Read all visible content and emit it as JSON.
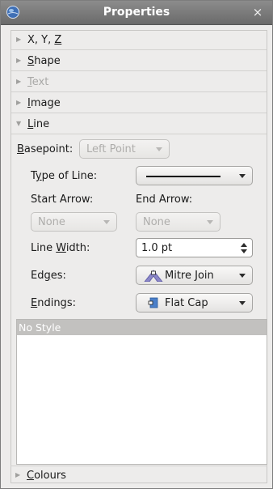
{
  "window": {
    "title": "Properties",
    "close_glyph": "×",
    "icon": "app-globe-icon"
  },
  "sections": {
    "xyz": {
      "prefix": "X, Y, ",
      "mnemonic": "Z",
      "suffix": ""
    },
    "shape": {
      "prefix": "",
      "mnemonic": "S",
      "suffix": "hape"
    },
    "text": {
      "prefix": "",
      "mnemonic": "T",
      "suffix": "ext",
      "disabled": true
    },
    "image": {
      "prefix": "",
      "mnemonic": "I",
      "suffix": "mage"
    },
    "line": {
      "prefix": "",
      "mnemonic": "L",
      "suffix": "ine",
      "expanded": true
    },
    "colours": {
      "prefix": "",
      "mnemonic": "C",
      "suffix": "olours"
    }
  },
  "line_panel": {
    "basepoint": {
      "mnemonic": "B",
      "label_rest": "asepoint:",
      "value": "Left Point",
      "disabled": true
    },
    "type_of_line": {
      "label_pre": "T",
      "mnemonic": "y",
      "label_rest": "pe of Line:"
    },
    "start_arrow": {
      "label": "Start Arrow:",
      "value": "None",
      "disabled": true
    },
    "end_arrow": {
      "label": "End Arrow:",
      "value": "None",
      "disabled": true
    },
    "line_width": {
      "label_pre": "Line ",
      "mnemonic": "W",
      "label_rest": "idth:",
      "value": "1.0 pt"
    },
    "edges": {
      "label_pre": "Ed",
      "mnemonic": "g",
      "label_rest": "es:",
      "value": "Mitre Join",
      "icon": "mitre-join-icon"
    },
    "endings": {
      "label_pre": "",
      "mnemonic": "E",
      "label_rest": "ndings:",
      "value": "Flat Cap",
      "icon": "flat-cap-icon"
    }
  },
  "style_list": {
    "header": "No Style"
  },
  "colors": {
    "titlebar": "#7a7a7a",
    "join_icon": "#8a86c8",
    "cap_icon": "#4a7fc9"
  }
}
